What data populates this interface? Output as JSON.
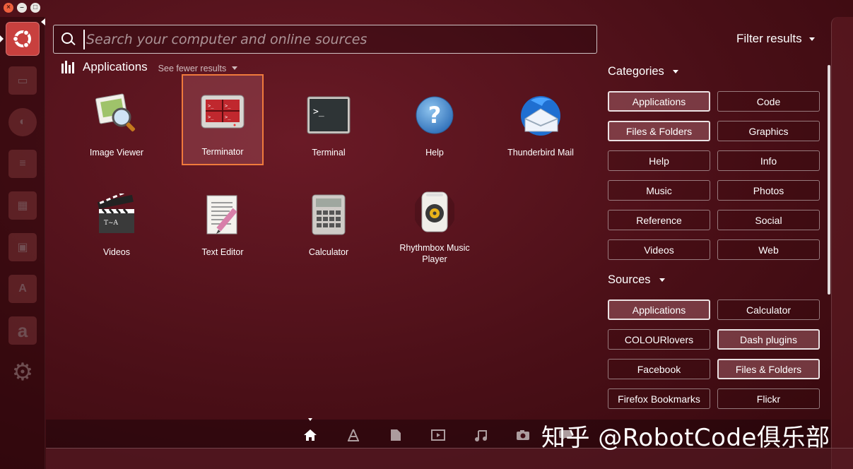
{
  "search": {
    "placeholder": "Search your computer and online sources"
  },
  "filter_header": {
    "label": "Filter results"
  },
  "results": {
    "category_title": "Applications",
    "see_fewer": "See fewer results",
    "apps": [
      {
        "label": "Image Viewer",
        "icon": "image-viewer-icon"
      },
      {
        "label": "Terminator",
        "icon": "terminator-icon",
        "selected": true
      },
      {
        "label": "Terminal",
        "icon": "terminal-icon"
      },
      {
        "label": "Help",
        "icon": "help-icon"
      },
      {
        "label": "Thunderbird Mail",
        "icon": "thunderbird-icon"
      },
      {
        "label": "Videos",
        "icon": "videos-icon"
      },
      {
        "label": "Text Editor",
        "icon": "text-editor-icon"
      },
      {
        "label": "Calculator",
        "icon": "calculator-icon"
      },
      {
        "label": "Rhythmbox Music Player",
        "icon": "rhythmbox-icon"
      }
    ]
  },
  "filters": {
    "categories_title": "Categories",
    "categories": [
      {
        "label": "Applications",
        "active": true
      },
      {
        "label": "Code",
        "active": false
      },
      {
        "label": "Files & Folders",
        "active": true
      },
      {
        "label": "Graphics",
        "active": false
      },
      {
        "label": "Help",
        "active": false
      },
      {
        "label": "Info",
        "active": false
      },
      {
        "label": "Music",
        "active": false
      },
      {
        "label": "Photos",
        "active": false
      },
      {
        "label": "Reference",
        "active": false
      },
      {
        "label": "Social",
        "active": false
      },
      {
        "label": "Videos",
        "active": false
      },
      {
        "label": "Web",
        "active": false
      }
    ],
    "sources_title": "Sources",
    "sources": [
      {
        "label": "Applications",
        "active": true
      },
      {
        "label": "Calculator",
        "active": false
      },
      {
        "label": "COLOURlovers",
        "active": false
      },
      {
        "label": "Dash plugins",
        "active": true
      },
      {
        "label": "Facebook",
        "active": false
      },
      {
        "label": "Files & Folders",
        "active": true
      },
      {
        "label": "Firefox Bookmarks",
        "active": false
      },
      {
        "label": "Flickr",
        "active": false
      }
    ]
  },
  "launcher": {
    "items": [
      "ubuntu-logo-icon",
      "file-manager-icon",
      "firefox-icon",
      "writer-icon",
      "calc-icon",
      "impress-icon",
      "software-center-icon",
      "amazon-icon",
      "settings-icon"
    ]
  },
  "lens_bar": {
    "icons": [
      "home-lens-icon",
      "applications-lens-icon",
      "files-lens-icon",
      "video-lens-icon",
      "music-lens-icon",
      "photo-lens-icon",
      "social-lens-icon"
    ]
  },
  "watermark": {
    "text": "知乎 @RobotCode俱乐部"
  },
  "colors": {
    "selection_border": "#f07a3c",
    "close_button": "#f0603e",
    "launcher_active": "#c8403e"
  }
}
